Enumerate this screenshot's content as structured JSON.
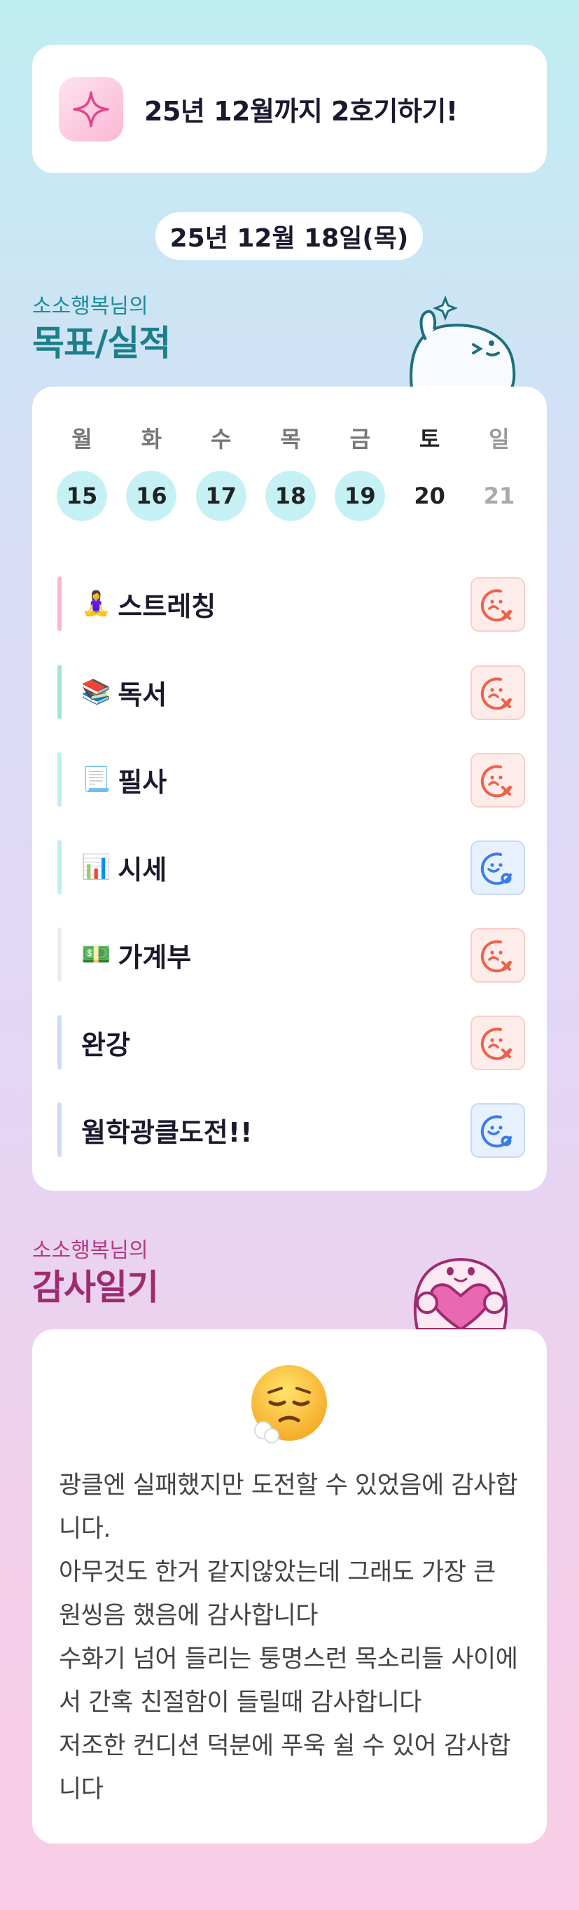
{
  "goal": {
    "text": "25년 12월까지 2호기하기!",
    "icon": "sparkle-icon"
  },
  "date": "25년 12월 18일(목)",
  "goals_section": {
    "subtitle": "소소행복님의",
    "title": "목표/실적"
  },
  "week": {
    "weekdays": [
      "월",
      "화",
      "수",
      "목",
      "금",
      "토",
      "일"
    ],
    "dates": [
      "15",
      "16",
      "17",
      "18",
      "19",
      "20",
      "21"
    ]
  },
  "tasks": [
    {
      "emoji": "🧘‍♀️",
      "name": "스트레칭",
      "status": "fail",
      "bar_color": "#f7b8d6"
    },
    {
      "emoji": "📚",
      "name": "독서",
      "status": "fail",
      "bar_color": "#a6e6cf"
    },
    {
      "emoji": "📃",
      "name": "필사",
      "status": "fail",
      "bar_color": "#bfeef2"
    },
    {
      "emoji": "📊",
      "name": "시세",
      "status": "pass",
      "bar_color": "#bfeef2"
    },
    {
      "emoji": "💵",
      "name": "가계부",
      "status": "fail",
      "bar_color": "#ececf0"
    },
    {
      "emoji": "",
      "name": "완강",
      "status": "fail",
      "bar_color": "#cfdcf8"
    },
    {
      "emoji": "",
      "name": "월학광클도전!!",
      "status": "pass",
      "bar_color": "#cfdcf8"
    }
  ],
  "diary_section": {
    "subtitle": "소소행복님의",
    "title": "감사일기"
  },
  "diary": {
    "mood_icon": "exhaling-face-icon",
    "text": "광클엔 실패했지만 도전할 수 있었음에 감사합니다.\n아무것도 한거 같지않았는데 그래도 가장 큰 원씽음 했음에 감사합니다\n수화기 넘어 들리는 퉁명스런 목소리들 사이에서 간혹 친절함이 들릴때 감사합니다\n저조한 컨디션 덕분에 푸욱 쉴 수 있어 감사합니다"
  },
  "colors": {
    "fail": "#f0604a",
    "pass": "#3b7de8",
    "teal": "#1c7f8a",
    "magenta": "#9e2b70"
  }
}
